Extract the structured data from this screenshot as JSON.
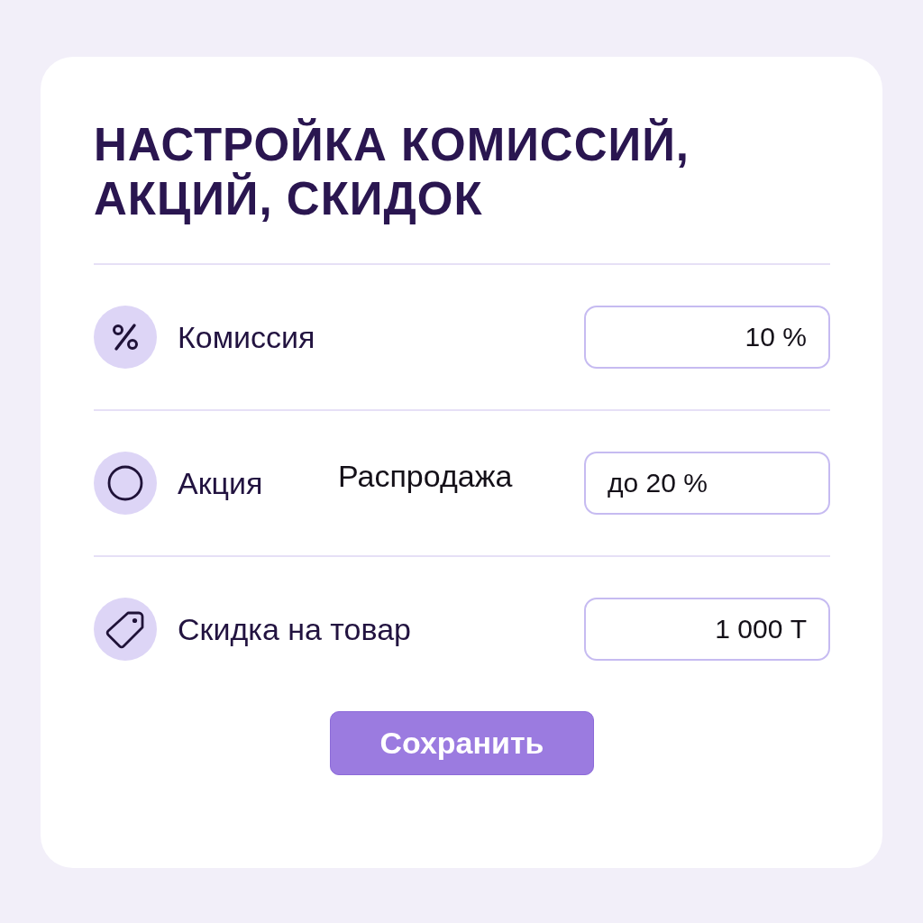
{
  "title": "НАСТРОЙКА КОМИССИЙ, АКЦИЙ, СКИДОК",
  "rows": [
    {
      "kind": "commission",
      "label": "Комиссия",
      "field": {
        "value": "10 %"
      }
    },
    {
      "kind": "promotion",
      "label": "Акция",
      "tag": "Распродажа",
      "field": {
        "value": "до 20 %"
      }
    },
    {
      "kind": "discount",
      "label": "Скидка на товар",
      "field": {
        "value": "1 000 Т"
      }
    }
  ],
  "save_button": {
    "label": "Сохранить"
  }
}
